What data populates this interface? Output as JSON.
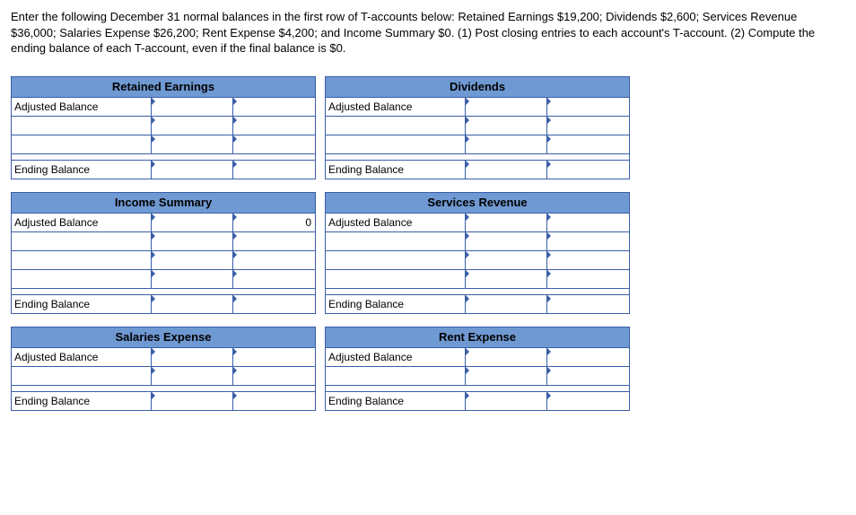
{
  "instructions": "Enter the following December 31 normal balances in the first row of T-accounts below: Retained Earnings $19,200; Dividends $2,600; Services Revenue $36,000; Salaries Expense $26,200; Rent Expense $4,200; and Income Summary $0. (1) Post closing entries to each account's T-account. (2) Compute the ending balance of each T-account, even if the final balance is $0.",
  "labels": {
    "adjusted": "Adjusted Balance",
    "ending": "Ending Balance"
  },
  "accounts": {
    "retained_earnings": {
      "title": "Retained Earnings",
      "body_rows": 3,
      "adjusted_value": ""
    },
    "dividends": {
      "title": "Dividends",
      "body_rows": 3,
      "adjusted_value": ""
    },
    "income_summary": {
      "title": "Income Summary",
      "body_rows": 4,
      "adjusted_value": "0"
    },
    "services_revenue": {
      "title": "Services Revenue",
      "body_rows": 4,
      "adjusted_value": ""
    },
    "salaries_expense": {
      "title": "Salaries Expense",
      "body_rows": 2,
      "adjusted_value": ""
    },
    "rent_expense": {
      "title": "Rent Expense",
      "body_rows": 2,
      "adjusted_value": ""
    }
  },
  "balances_given": {
    "retained_earnings": 19200,
    "dividends": 2600,
    "services_revenue": 36000,
    "salaries_expense": 26200,
    "rent_expense": 4200,
    "income_summary": 0
  }
}
